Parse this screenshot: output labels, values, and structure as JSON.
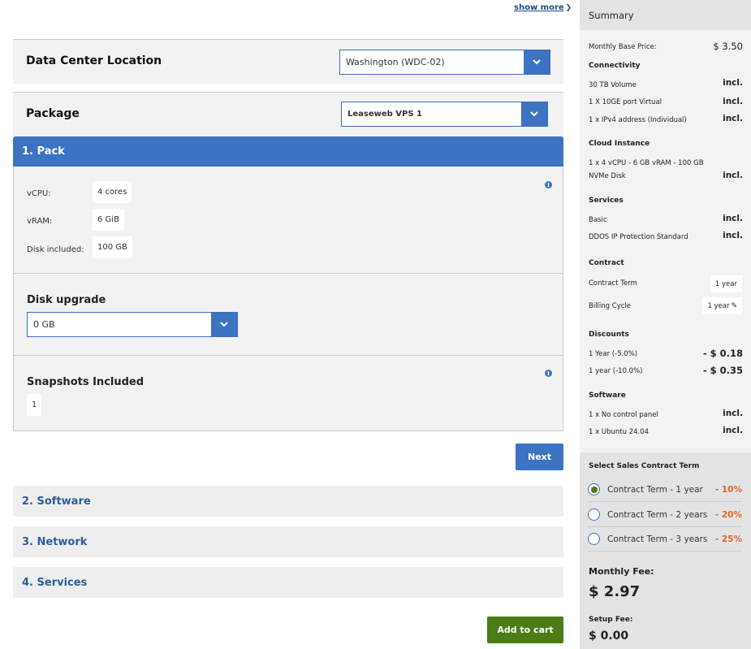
{
  "show_more": "show more",
  "datacenter": {
    "title": "Data Center Location",
    "value": "Washington (WDC-02)"
  },
  "package": {
    "title": "Package",
    "value": "Leaseweb VPS 1"
  },
  "pack": {
    "header": "1. Pack",
    "rows": [
      {
        "label": "vCPU:",
        "value": "4 cores"
      },
      {
        "label": "vRAM:",
        "value": "6 GiB"
      },
      {
        "label": "Disk included:",
        "value": "100 GB"
      }
    ],
    "disk_upgrade": {
      "title": "Disk upgrade",
      "value": "0 GB"
    },
    "snapshots": {
      "title": "Snapshots Included",
      "value": "1"
    },
    "info_glyph": "i"
  },
  "next_label": "Next",
  "sections": [
    "2. Software",
    "3. Network",
    "4. Services"
  ],
  "add_to_cart": "Add to cart",
  "summary": {
    "title": "Summary",
    "monthly_base_label": "Monthly Base Price:",
    "monthly_base_value": "$ 3.50",
    "connectivity": {
      "title": "Connectivity",
      "items": [
        {
          "label": "30 TB Volume",
          "value": "incl."
        },
        {
          "label": "1 X 10GE port Virtual",
          "value": "incl."
        },
        {
          "label": "1 x IPv4 address (Individual)",
          "value": "incl."
        }
      ]
    },
    "cloud_instance": {
      "title": "Cloud Instance",
      "line1": "1 x 4 vCPU - 6 GB vRAM - 100 GB",
      "line2": "NVMe Disk",
      "value": "incl."
    },
    "services": {
      "title": "Services",
      "items": [
        {
          "label": "Basic",
          "value": "incl."
        },
        {
          "label": "DDOS IP Protection Standard",
          "value": "incl."
        }
      ]
    },
    "contract": {
      "title": "Contract",
      "term_label": "Contract Term",
      "term_value": "1 year",
      "billing_label": "Billing Cycle",
      "billing_value": "1 year"
    },
    "discounts": {
      "title": "Discounts",
      "items": [
        {
          "label": "1 Year (-5.0%)",
          "value": "- $ 0.18"
        },
        {
          "label": "1 year (-10.0%)",
          "value": "- $ 0.35"
        }
      ]
    },
    "software": {
      "title": "Software",
      "items": [
        {
          "label": "1 x No control panel",
          "value": "incl."
        },
        {
          "label": "1 x Ubuntu 24.04",
          "value": "incl."
        }
      ]
    },
    "sales_term": {
      "title": "Select Sales Contract Term",
      "options": [
        {
          "label": "Contract Term - 1 year",
          "discount": "- 10%",
          "selected": true
        },
        {
          "label": "Contract Term - 2 years",
          "discount": "- 20%",
          "selected": false
        },
        {
          "label": "Contract Term - 3 years",
          "discount": "- 25%",
          "selected": false
        }
      ]
    },
    "monthly_fee_label": "Monthly Fee:",
    "monthly_fee_value": "$ 2.97",
    "setup_fee_label": "Setup Fee:",
    "setup_fee_value": "$ 0.00"
  },
  "colors": {
    "accent": "#3c73c2",
    "cart": "#4c7c15",
    "discount": "#e0642a"
  }
}
